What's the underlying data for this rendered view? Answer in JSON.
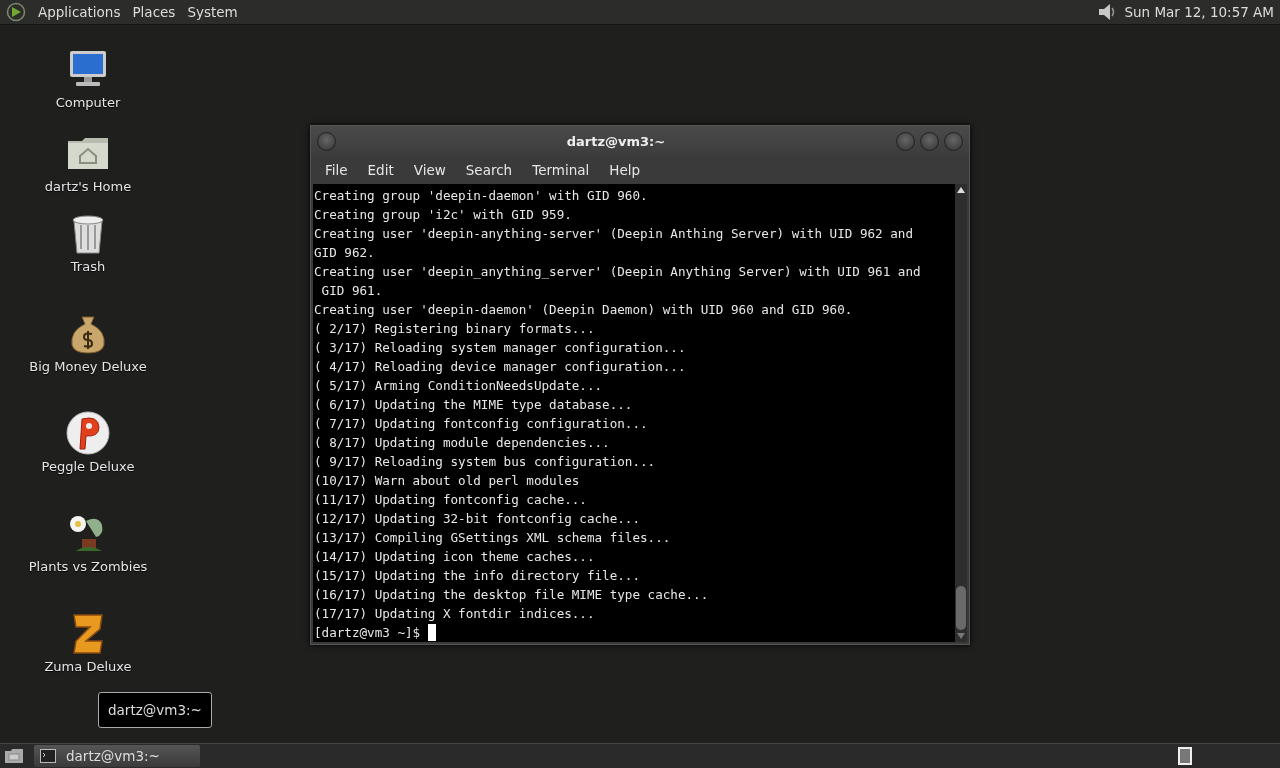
{
  "top_panel": {
    "menus": [
      "Applications",
      "Places",
      "System"
    ],
    "clock": "Sun Mar 12, 10:57 AM"
  },
  "desktop_icons": [
    {
      "kind": "computer",
      "label": "Computer"
    },
    {
      "kind": "home",
      "label": "dartz's Home"
    },
    {
      "kind": "trash",
      "label": "Trash"
    },
    {
      "kind": "money",
      "label": "Big Money Deluxe"
    },
    {
      "kind": "peggle",
      "label": "Peggle Deluxe"
    },
    {
      "kind": "plants",
      "label": "Plants vs Zombies"
    },
    {
      "kind": "zuma",
      "label": "Zuma Deluxe"
    }
  ],
  "terminal_window": {
    "title": "dartz@vm3:~",
    "menus": [
      "File",
      "Edit",
      "View",
      "Search",
      "Terminal",
      "Help"
    ],
    "lines": [
      "Creating group 'deepin-daemon' with GID 960.",
      "Creating group 'i2c' with GID 959.",
      "Creating user 'deepin-anything-server' (Deepin Anthing Server) with UID 962 and",
      "GID 962.",
      "Creating user 'deepin_anything_server' (Deepin Anything Server) with UID 961 and",
      " GID 961.",
      "Creating user 'deepin-daemon' (Deepin Daemon) with UID 960 and GID 960.",
      "( 2/17) Registering binary formats...",
      "( 3/17) Reloading system manager configuration...",
      "( 4/17) Reloading device manager configuration...",
      "( 5/17) Arming ConditionNeedsUpdate...",
      "( 6/17) Updating the MIME type database...",
      "( 7/17) Updating fontconfig configuration...",
      "( 8/17) Updating module dependencies...",
      "( 9/17) Reloading system bus configuration...",
      "(10/17) Warn about old perl modules",
      "(11/17) Updating fontconfig cache...",
      "(12/17) Updating 32-bit fontconfig cache...",
      "(13/17) Compiling GSettings XML schema files...",
      "(14/17) Updating icon theme caches...",
      "(15/17) Updating the info directory file...",
      "(16/17) Updating the desktop file MIME type cache...",
      "(17/17) Updating X fontdir indices..."
    ],
    "prompt": "[dartz@vm3 ~]$"
  },
  "tooltip": "dartz@vm3:~",
  "taskbar": {
    "tasks": [
      {
        "label": "dartz@vm3:~",
        "selected": true
      }
    ]
  }
}
